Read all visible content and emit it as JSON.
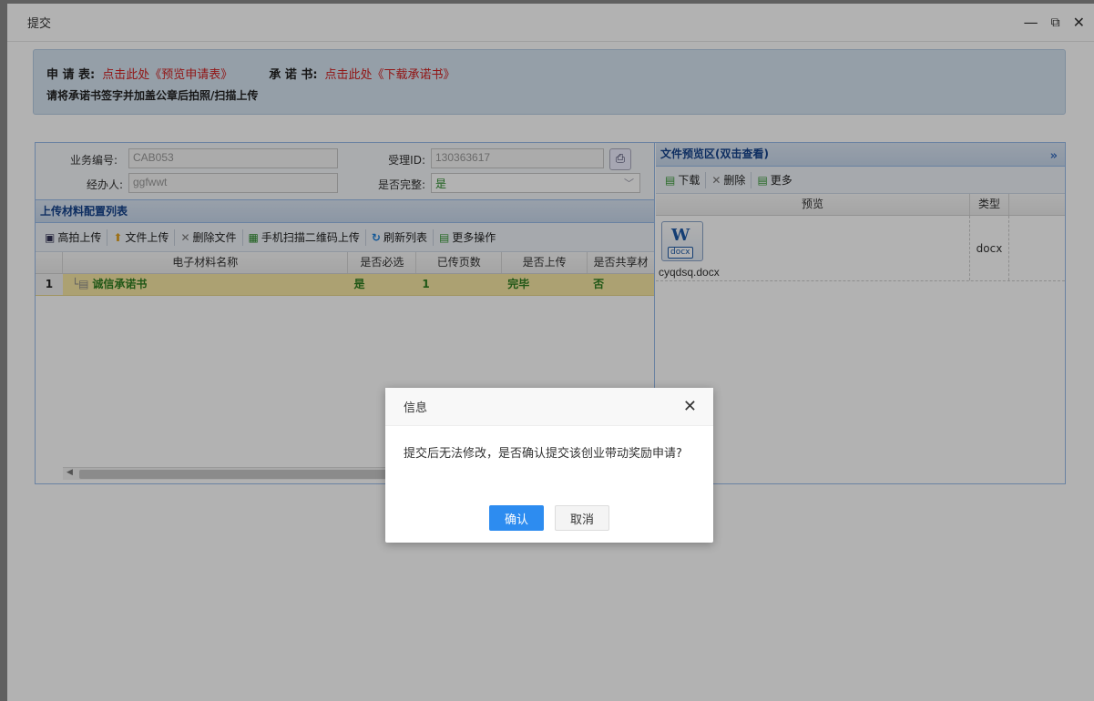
{
  "window": {
    "title": "提交",
    "minimize_icon": "minimize-icon",
    "maximize_icon": "maximize-icon",
    "close_icon": "close-icon"
  },
  "notice": {
    "application_label": "申 请 表:",
    "application_link": "点击此处《预览申请表》",
    "commitment_label": "承 诺 书:",
    "commitment_link": "点击此处《下载承诺书》",
    "instruction": "请将承诺书签字并加盖公章后拍照/扫描上传"
  },
  "form": {
    "business_no_label": "业务编号:",
    "business_no_value": "CAB053",
    "accept_id_label": "受理ID:",
    "accept_id_value": "130363617",
    "handler_label": "经办人:",
    "handler_value": "ggfwwt",
    "complete_label": "是否完整:",
    "complete_value": "是"
  },
  "upload_panel": {
    "title": "上传材料配置列表",
    "toolbar": [
      {
        "label": "高拍上传",
        "icon": "camera-icon"
      },
      {
        "label": "文件上传",
        "icon": "upload-icon"
      },
      {
        "label": "删除文件",
        "icon": "delete-icon"
      },
      {
        "label": "手机扫描二维码上传",
        "icon": "qrcode-icon"
      },
      {
        "label": "刷新列表",
        "icon": "refresh-icon"
      },
      {
        "label": "更多操作",
        "icon": "more-icon"
      }
    ],
    "columns": [
      "电子材料名称",
      "是否必选",
      "已传页数",
      "是否上传",
      "是否共享材"
    ],
    "rows": [
      {
        "num": "1",
        "name": "诚信承诺书",
        "required": "是",
        "pages": "1",
        "uploaded": "完毕",
        "shared": "否"
      }
    ]
  },
  "preview_panel": {
    "title": "文件预览区(双击查看)",
    "toolbar": [
      {
        "label": "下载",
        "icon": "download-icon"
      },
      {
        "label": "删除",
        "icon": "delete-icon"
      },
      {
        "label": "更多",
        "icon": "more-icon"
      }
    ],
    "columns": [
      "预览",
      "类型"
    ],
    "files": [
      {
        "icon_label": "docx",
        "name": "cyqdsq.docx",
        "type": "docx"
      }
    ]
  },
  "dialog": {
    "title": "信息",
    "message": "提交后无法修改，是否确认提交该创业带动奖励申请?",
    "confirm": "确认",
    "cancel": "取消"
  },
  "colors": {
    "primary_button": "#2d8cf0",
    "link_red": "#d02020",
    "row_highlight": "#f6e7a4",
    "row_text_green": "#2e7d20"
  }
}
